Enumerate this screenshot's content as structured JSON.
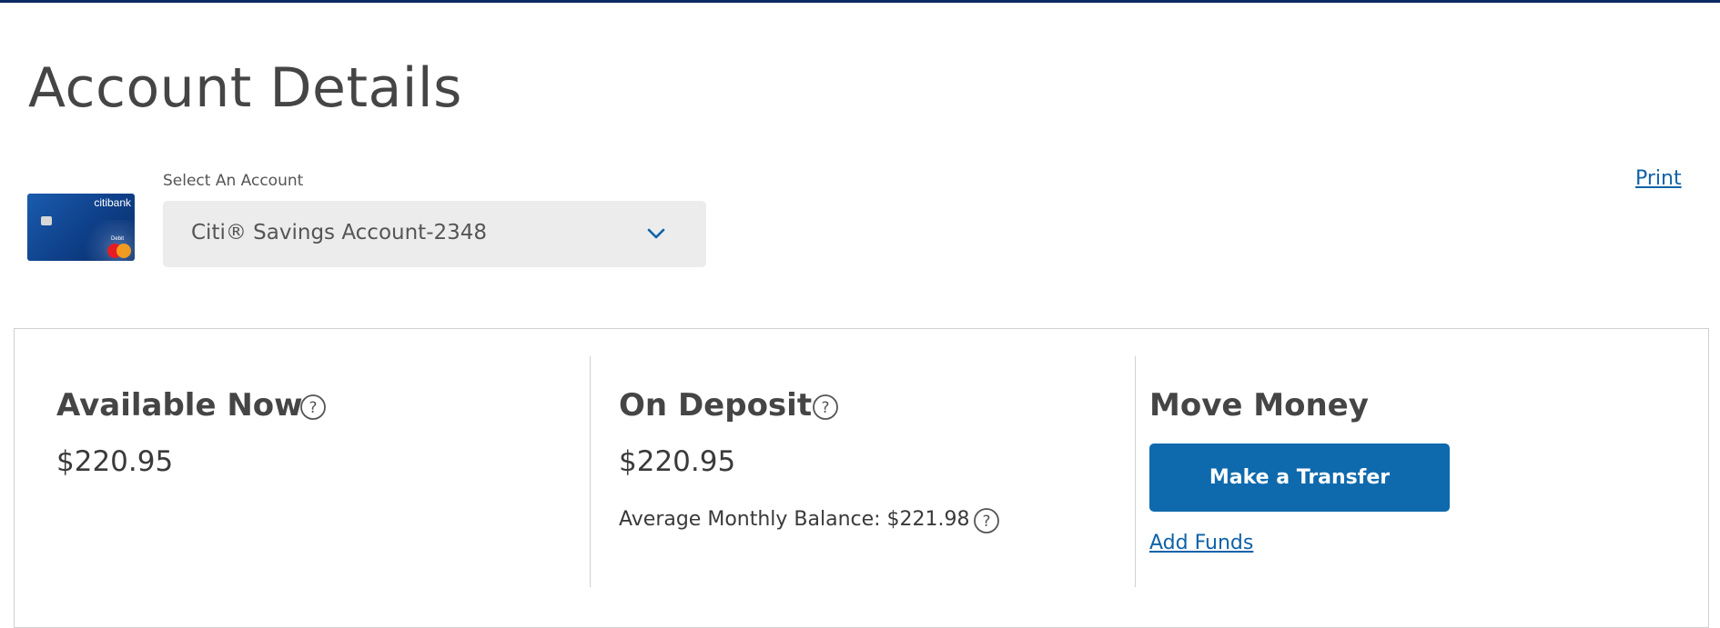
{
  "header": {
    "title": "Account Details",
    "print_label": "Print"
  },
  "account_selector": {
    "label": "Select An Account",
    "selected": "Citi® Savings Account-2348",
    "card_brand": "citibank",
    "card_type": "Debit"
  },
  "summary": {
    "available": {
      "title": "Available Now",
      "amount": "$220.95"
    },
    "on_deposit": {
      "title": "On Deposit",
      "amount": "$220.95",
      "average_label": "Average Monthly Balance: $221.98"
    },
    "move_money": {
      "title": "Move Money",
      "transfer_label": "Make a Transfer",
      "add_funds_label": "Add Funds"
    }
  },
  "colors": {
    "accent": "#0f6aad",
    "link": "#0f62a8",
    "top_rule": "#0b2a63",
    "select_bg": "#ececec"
  },
  "icons": [
    "help-icon",
    "chevron-down-icon",
    "mastercard-logo"
  ]
}
